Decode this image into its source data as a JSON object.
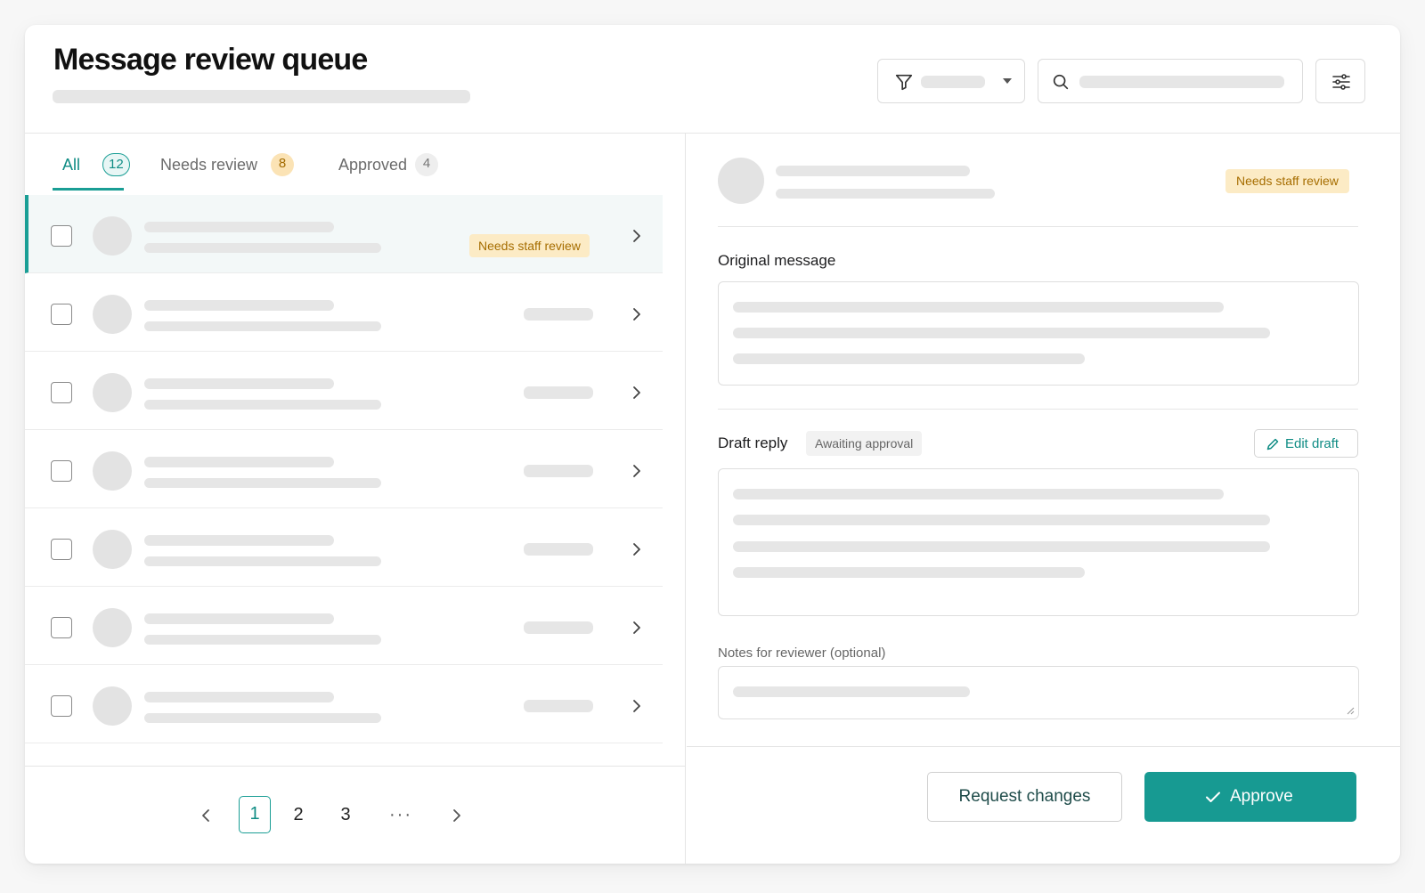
{
  "header": {
    "title": "Message review queue",
    "search_placeholder": ""
  },
  "tabs": [
    {
      "label": "All",
      "count": "12"
    },
    {
      "label": "Needs review",
      "count": "8"
    },
    {
      "label": "Approved",
      "count": "4"
    }
  ],
  "list": {
    "rows": [
      {
        "status": "Needs staff review",
        "selected": true
      },
      {
        "status": ""
      },
      {
        "status": ""
      },
      {
        "status": ""
      },
      {
        "status": ""
      },
      {
        "status": ""
      },
      {
        "status": ""
      }
    ]
  },
  "pagination": {
    "pages": [
      "1",
      "2",
      "3"
    ],
    "ellipsis": "···",
    "current": "1"
  },
  "detail": {
    "status": "Needs staff review",
    "original_label": "Original message",
    "draft_label": "Draft reply",
    "draft_status": "Awaiting approval",
    "edit_label": "Edit draft",
    "notes_label": "Notes for reviewer (optional)",
    "notes_placeholder": ""
  },
  "actions": {
    "request_changes": "Request changes",
    "approve": "Approve"
  },
  "colors": {
    "accent": "#179a92",
    "warning_bg": "#fcebc5",
    "warning_text": "#a66d00"
  }
}
